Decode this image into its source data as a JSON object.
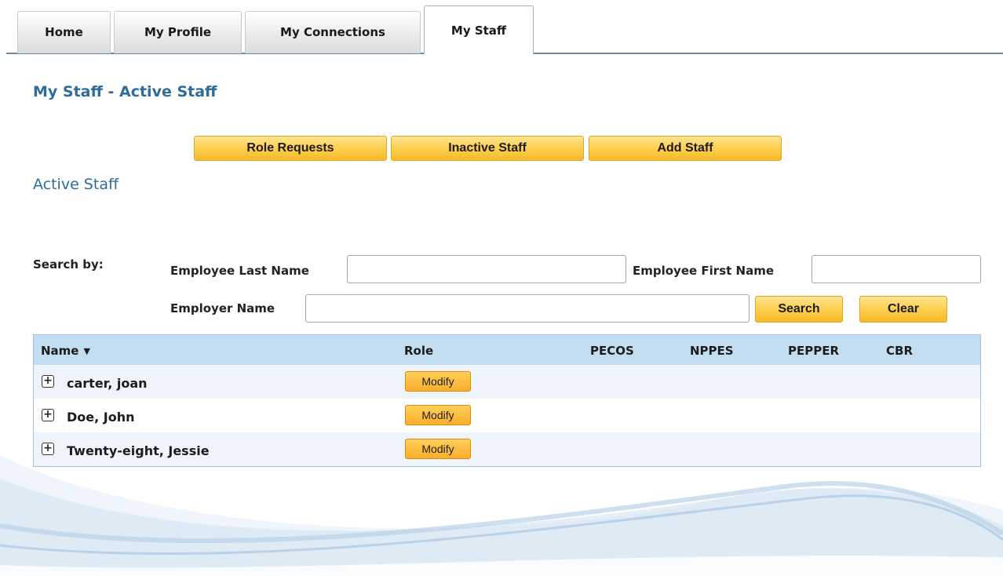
{
  "tabs": [
    "Home",
    "My Profile",
    "My Connections",
    "My Staff"
  ],
  "active_tab": "My Staff",
  "page_title": "My Staff - Active Staff",
  "action_buttons": {
    "role_requests": "Role Requests",
    "inactive_staff": "Inactive Staff",
    "add_staff": "Add Staff"
  },
  "section_title": "Active Staff",
  "search": {
    "label": "Search by:",
    "last_name_label": "Employee Last Name",
    "last_name_value": "",
    "first_name_label": "Employee First Name",
    "first_name_value": "",
    "employer_label": "Employer Name",
    "employer_value": "",
    "search_button": "Search",
    "clear_button": "Clear"
  },
  "table": {
    "columns": [
      "Name",
      "Role",
      "PECOS",
      "NPPES",
      "PEPPER",
      "CBR"
    ],
    "sort_icon": "caret-down-icon",
    "rows": [
      {
        "name": "carter, joan",
        "action": "Modify"
      },
      {
        "name": "Doe, John",
        "action": "Modify"
      },
      {
        "name": "Twenty-eight, Jessie",
        "action": "Modify"
      }
    ]
  },
  "colors": {
    "title_blue": "#2e6c99",
    "button_gold": "#fccd4a",
    "table_header": "#c3def0"
  }
}
